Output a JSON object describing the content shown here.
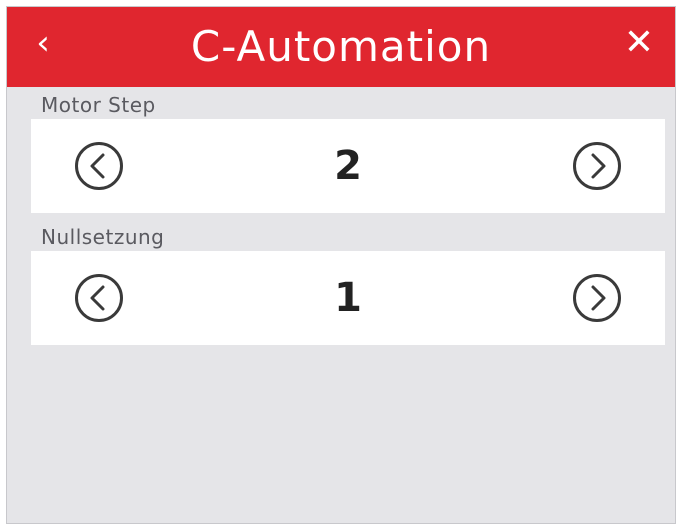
{
  "header": {
    "title": "C-Automation",
    "back_icon": "‹",
    "close_icon": "✕",
    "color": "#e0262f"
  },
  "settings": [
    {
      "label": "Motor Step",
      "value": "2"
    },
    {
      "label": "Nullsetzung",
      "value": "1"
    }
  ]
}
